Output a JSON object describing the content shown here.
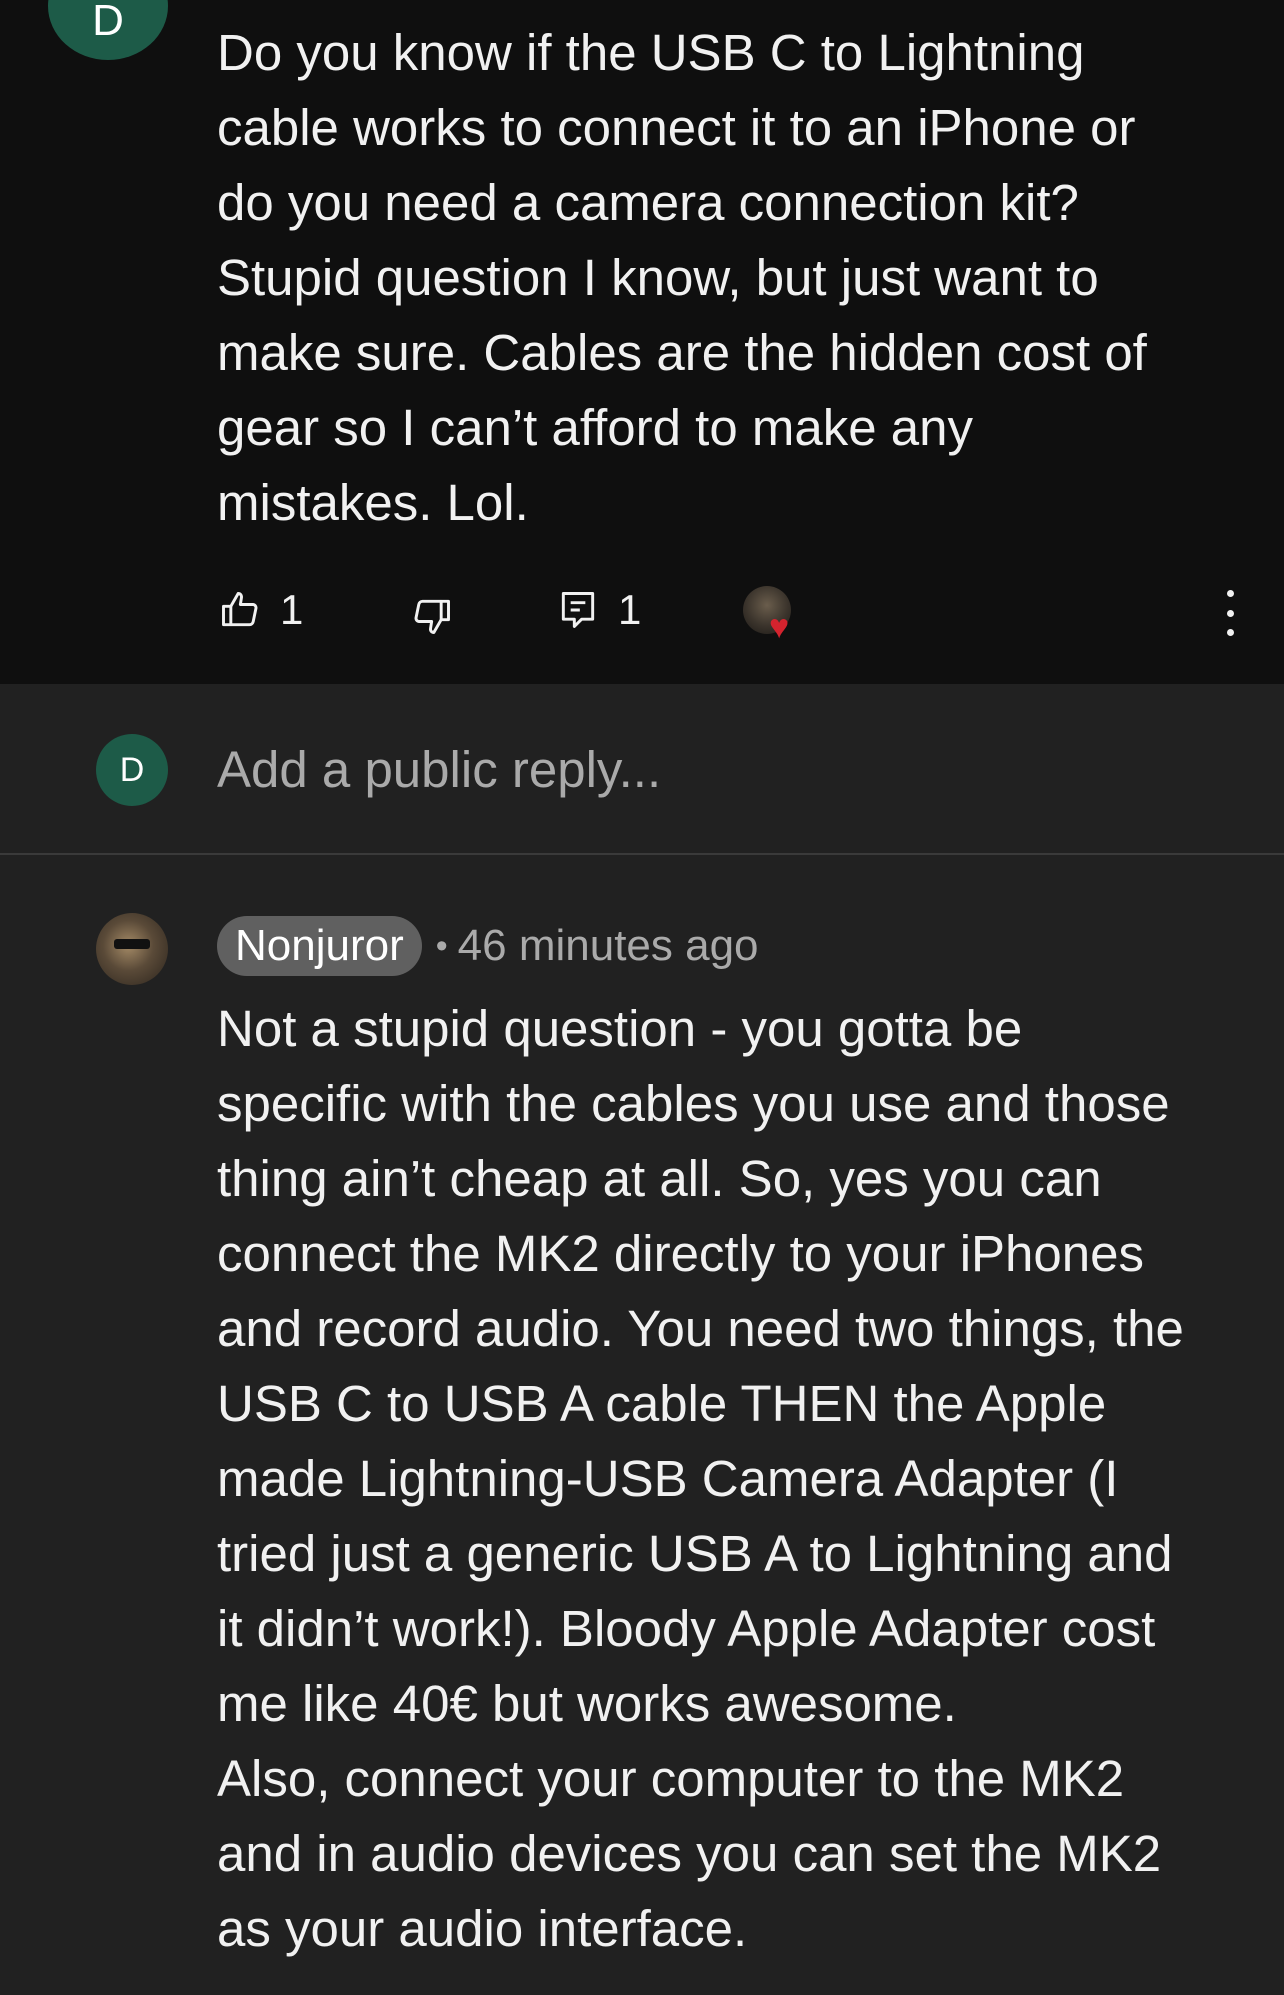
{
  "top_comment": {
    "avatar_letter": "D",
    "text": "Do you know if the USB C to Lightning\ncable works to connect it to an iPhone or\ndo you need a camera connection kit?\nStupid question I know, but just want to\nmake sure. Cables are the hidden cost of\ngear so I can’t afford to make any\nmistakes. Lol.",
    "like_count": "1",
    "reply_count": "1",
    "icons": {
      "like": "thumbs-up-icon",
      "dislike": "thumbs-down-icon",
      "reply": "comment-icon",
      "creator_heart": "heart-icon",
      "more": "more-vertical-icon"
    },
    "colors": {
      "avatar_bg": "#1d5b48",
      "heart": "#d4232e"
    }
  },
  "reply_box": {
    "avatar_letter": "D",
    "placeholder": "Add a public reply..."
  },
  "reply": {
    "author": "Nonjuror",
    "separator": "•",
    "timestamp": "46 minutes ago",
    "text": "Not a stupid question - you gotta be\nspecific with the cables you use and those\nthing ain’t cheap at all. So, yes you can\nconnect the MK2 directly to your iPhones\nand record audio. You need two things, the\nUSB C to USB A cable THEN the Apple\nmade Lightning-USB Camera Adapter (I\ntried just a generic USB A to Lightning and\nit didn’t work!). Bloody Apple Adapter cost\nme like 40€ but works awesome.\nAlso, connect your computer to the MK2\nand in audio devices you can set the MK2\nas your audio interface."
  }
}
